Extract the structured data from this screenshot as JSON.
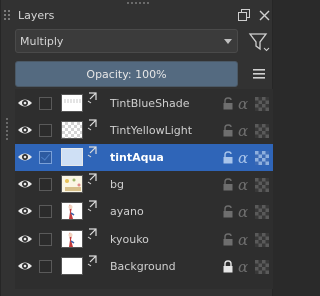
{
  "panel": {
    "title": "Layers",
    "float_button": "float-icon",
    "close_button": "close-icon"
  },
  "blending": {
    "mode": "Multiply",
    "filter_icon": "filter-icon"
  },
  "opacity": {
    "label": "Opacity:  100%",
    "value_percent": 100,
    "menu_icon": "hamburger-menu-icon"
  },
  "colors": {
    "accent": "#2f65b8",
    "opacity_fill": "#546a80"
  },
  "layers": [
    {
      "name": "TintBlueShade",
      "visible": true,
      "locked": false,
      "active": false,
      "thumb": "stroke"
    },
    {
      "name": "TintYellowLight",
      "visible": true,
      "locked": false,
      "active": false,
      "thumb": "checker"
    },
    {
      "name": "tintAqua",
      "visible": true,
      "locked": false,
      "active": true,
      "thumb": "light-blue"
    },
    {
      "name": "bg",
      "visible": true,
      "locked": false,
      "active": false,
      "thumb": "scene"
    },
    {
      "name": "ayano",
      "visible": true,
      "locked": false,
      "active": false,
      "thumb": "character"
    },
    {
      "name": "kyouko",
      "visible": true,
      "locked": false,
      "active": false,
      "thumb": "character"
    },
    {
      "name": "Background",
      "visible": true,
      "locked": true,
      "active": false,
      "thumb": "white"
    }
  ]
}
